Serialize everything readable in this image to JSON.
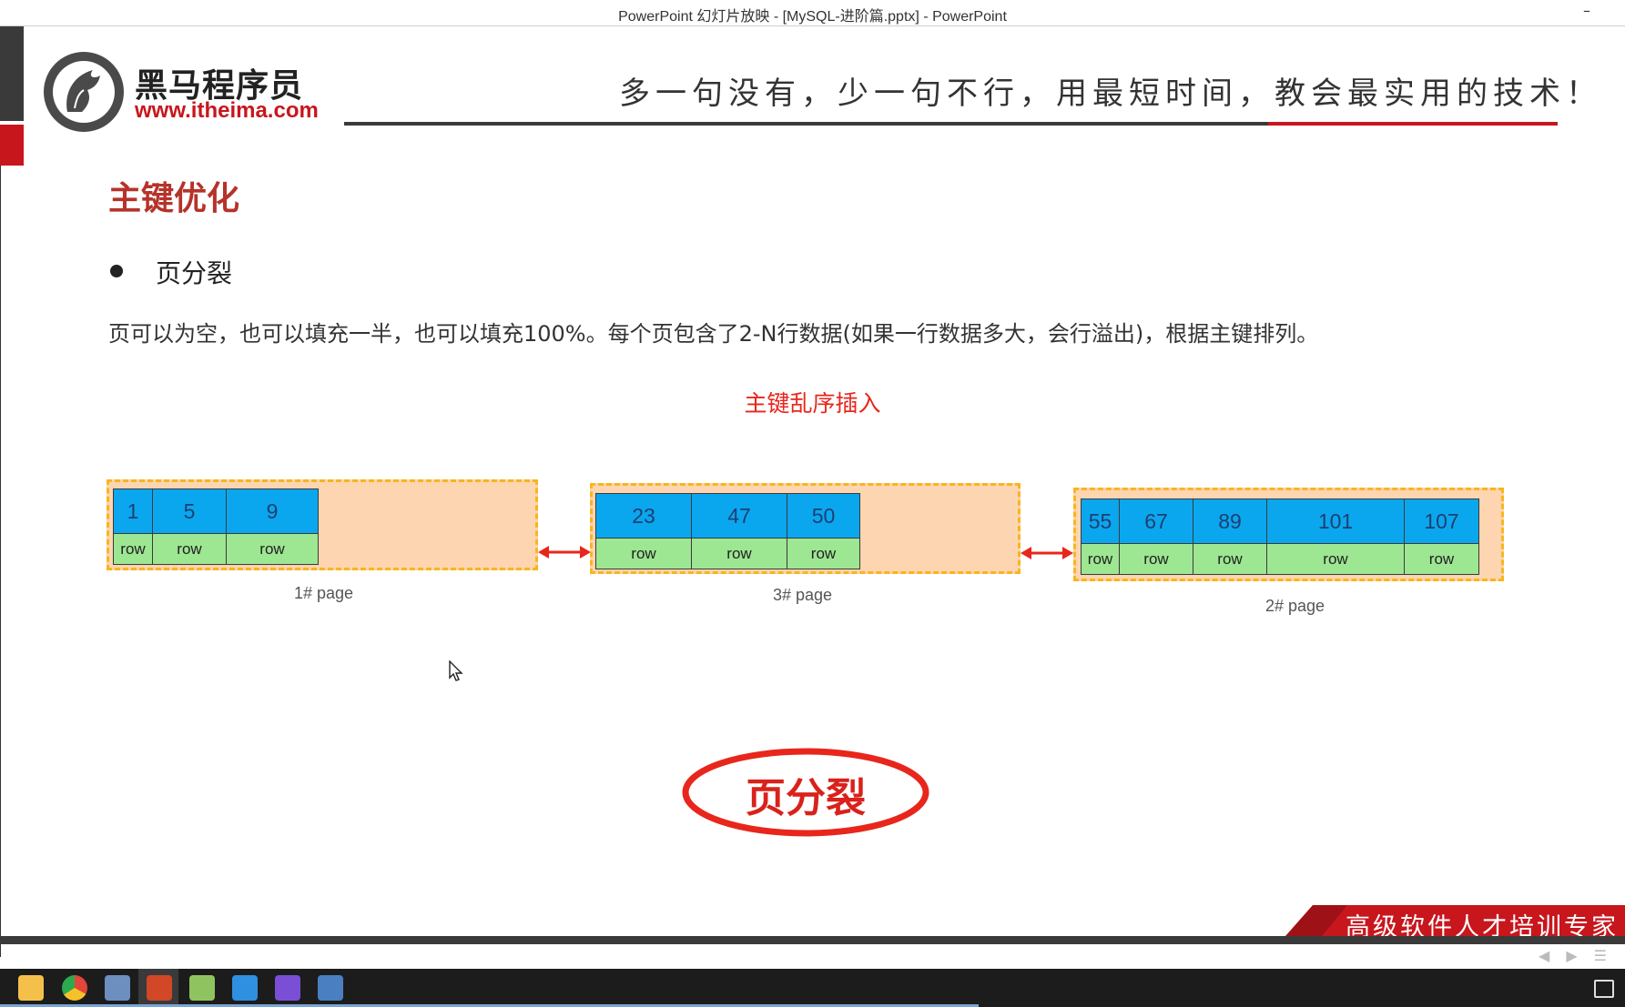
{
  "window": {
    "title": "PowerPoint 幻灯片放映 - [MySQL-进阶篇.pptx] - PowerPoint",
    "minimize_glyph": "–"
  },
  "header": {
    "logo_name": "黑马程序员",
    "logo_url": "www.itheima.com",
    "slogan": "多一句没有，少一句不行，用最短时间，教会最实用的技术！"
  },
  "slide": {
    "section_title": "主键优化",
    "bullet": "页分裂",
    "description": "页可以为空，也可以填充一半，也可以填充100%。每个页包含了2-N行数据(如果一行数据多大，会行溢出)，根据主键排列。",
    "diagram_caption": "主键乱序插入",
    "split_label": "页分裂",
    "footer_slogan": "高级软件人才培训专家"
  },
  "pages": [
    {
      "label": "1#  page",
      "keys": [
        "1",
        "5",
        "9"
      ],
      "row_label": "row"
    },
    {
      "label": "3#  page",
      "keys": [
        "23",
        "47",
        "50"
      ],
      "row_label": "row"
    },
    {
      "label": "2#  page",
      "keys": [
        "55",
        "67",
        "89",
        "101",
        "107"
      ],
      "row_label": "row"
    }
  ],
  "colors": {
    "accent_red": "#c8161d",
    "key_cell": "#0aa7ee",
    "row_cell": "#9de692",
    "page_fill": "#fdd5b0",
    "page_border": "#f7b61d"
  },
  "taskbar": {
    "icons": [
      "file-explorer-icon",
      "chrome-icon",
      "paint-icon",
      "powerpoint-icon",
      "notepad-icon",
      "app-blue-icon",
      "datagrip-icon",
      "remote-desktop-icon"
    ]
  }
}
